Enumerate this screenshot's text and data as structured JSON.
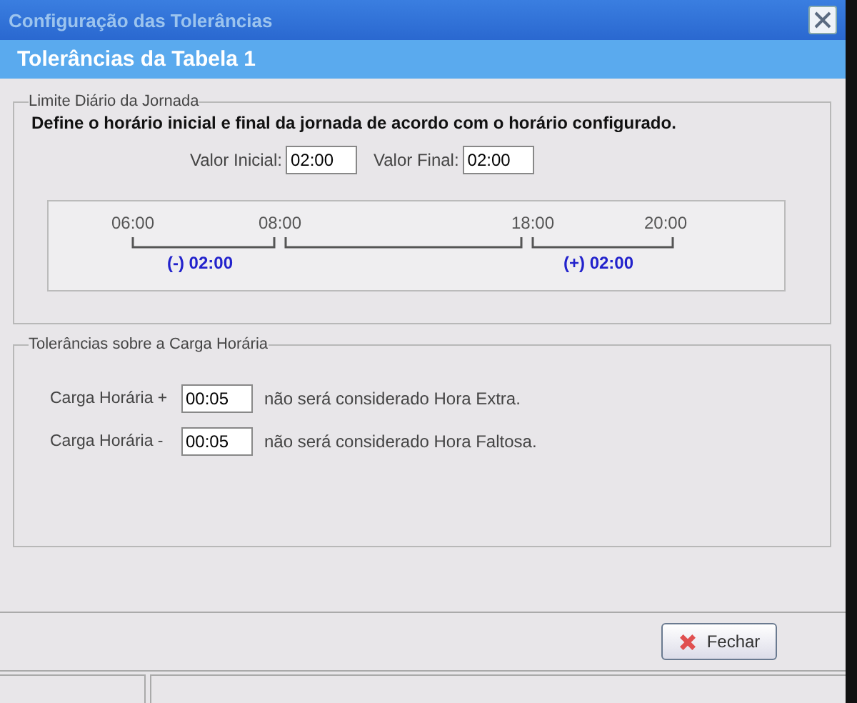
{
  "window": {
    "title": "Configuração das Tolerâncias"
  },
  "header": "Tolerâncias da Tabela 1",
  "daily_limit": {
    "legend": "Limite Diário da Jornada",
    "description": "Define o horário inicial e final da jornada de acordo com o horário configurado.",
    "fields": [
      {
        "label": "Valor Inicial:",
        "value": "02:00"
      },
      {
        "label": "Valor Final:",
        "value": "02:00"
      }
    ],
    "timeline": {
      "ticks": [
        "06:00",
        "08:00",
        "18:00",
        "20:00"
      ],
      "tolerance_labels": [
        "(-) 02:00",
        "(+) 02:00"
      ]
    }
  },
  "workload": {
    "legend": "Tolerâncias sobre a Carga Horária",
    "rows": [
      {
        "label": "Carga Horária +",
        "value": "00:05",
        "note": "não será considerado Hora Extra."
      },
      {
        "label": "Carga Horária -",
        "value": "00:05",
        "note": "não será considerado Hora Faltosa."
      }
    ]
  },
  "buttons": [
    {
      "label": "Fechar"
    }
  ]
}
